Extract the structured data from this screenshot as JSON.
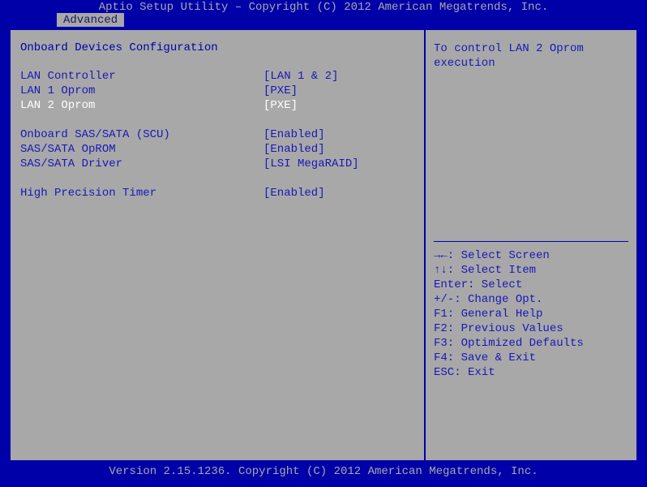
{
  "title": "Aptio Setup Utility – Copyright (C) 2012 American Megatrends, Inc.",
  "footer": "Version 2.15.1236. Copyright (C) 2012 American Megatrends, Inc.",
  "tab": "Advanced",
  "section_title": "Onboard Devices Configuration",
  "settings": {
    "lan_ctrl": {
      "label": "LAN Controller",
      "value": "[LAN 1 & 2]"
    },
    "lan1_oprom": {
      "label": "LAN 1 Oprom",
      "value": "[PXE]"
    },
    "lan2_oprom": {
      "label": "LAN 2 Oprom",
      "value": "[PXE]"
    },
    "sas_scu": {
      "label": "Onboard SAS/SATA (SCU)",
      "value": "[Enabled]"
    },
    "sas_oprom": {
      "label": "SAS/SATA OpROM",
      "value": "[Enabled]"
    },
    "sas_drv": {
      "label": "SAS/SATA Driver",
      "value": "[LSI MegaRAID]"
    },
    "hpet": {
      "label": "High Precision Timer",
      "value": "[Enabled]"
    }
  },
  "help_text": "To control LAN 2 Oprom execution",
  "hints": {
    "screen": "→←: Select Screen",
    "item": "↑↓: Select Item",
    "enter": "Enter: Select",
    "opt": "+/-: Change Opt.",
    "f1": "F1: General Help",
    "f2": "F2: Previous Values",
    "f3": "F3: Optimized Defaults",
    "f4": "F4: Save & Exit",
    "esc": "ESC: Exit"
  }
}
